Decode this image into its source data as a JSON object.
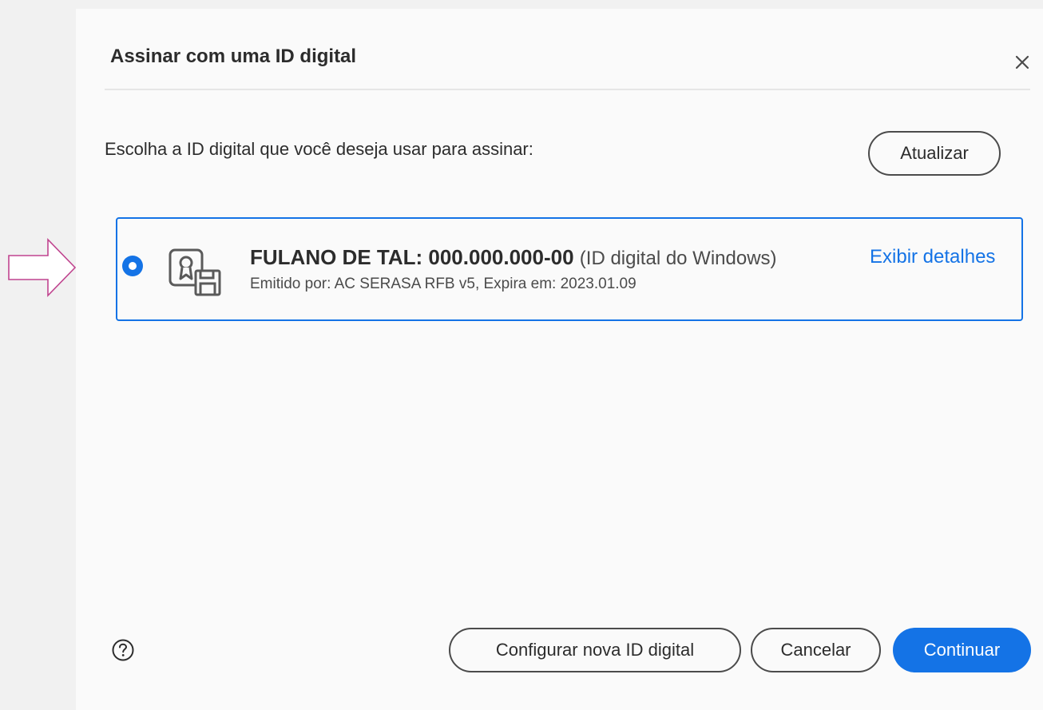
{
  "dialog": {
    "title": "Assinar com uma ID digital",
    "close_icon": "close-icon",
    "prompt": "Escolha a ID digital que você deseja usar para assinar:",
    "refresh_label": "Atualizar"
  },
  "digital_ids": [
    {
      "selected": true,
      "icon": "certificate-icon",
      "name": "FULANO DE TAL: 000.000.000-00",
      "type": "(ID digital do Windows)",
      "details_link": "Exibir detalhes",
      "subtitle": "Emitido por: AC SERASA RFB v5, Expira em: 2023.01.09"
    }
  ],
  "footer": {
    "help_icon": "help-icon",
    "configure_label": "Configurar nova ID digital",
    "cancel_label": "Cancelar",
    "continue_label": "Continuar"
  },
  "colors": {
    "accent": "#1473e6",
    "annotation_arrow": "#c0448f",
    "text": "#2c2c2c",
    "background": "#fafafa"
  }
}
